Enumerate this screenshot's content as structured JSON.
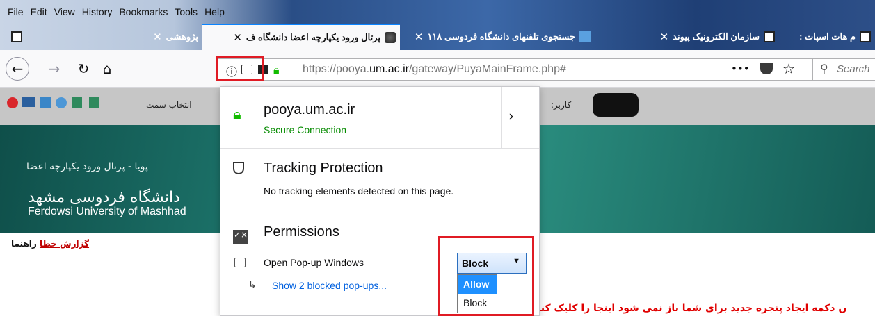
{
  "menu": [
    "File",
    "Edit",
    "View",
    "History",
    "Bookmarks",
    "Tools",
    "Help"
  ],
  "tabs": [
    {
      "label": "پژوهشی"
    },
    {
      "label": "پرتال ورود یکپارچه اعضا دانشگاه ف"
    },
    {
      "label": "جستجوی تلفنهای دانشگاه فردوسی ۱۱۸"
    },
    {
      "label": "سازمان الکترونیک پیوند"
    },
    {
      "label": "م هات اسپات :"
    }
  ],
  "nav": {
    "url_prefix": "https://pooya.",
    "url_domain": "um.ac.ir",
    "url_suffix": "/gateway/PuyaMainFrame.php#",
    "search_placeholder": "Search",
    "more": "•••"
  },
  "page": {
    "role_label": "انتخاب سمت",
    "user_label": "کاربر:",
    "banner_line1": "پویا - پرتال ورود یکپارچه اعضا",
    "banner_line2": "دانشگاه فردوسی مشهد",
    "banner_line3": "Ferdowsi University of Mashhad",
    "report_link": "گزارش خطا",
    "help_link": "راهنما",
    "bottom_message": "ن دکمه ایجاد پنجره جدید برای شما باز نمی شود اینجا را کلیک کنید"
  },
  "panel": {
    "host": "pooya.um.ac.ir",
    "connection": "Secure Connection",
    "tracking_title": "Tracking Protection",
    "tracking_desc": "No tracking elements detected on this page.",
    "permissions_title": "Permissions",
    "popup_label": "Open Pop-up Windows",
    "popup_value": "Block",
    "show_blocked": "Show 2 blocked pop-ups...",
    "options": [
      "Allow",
      "Block"
    ],
    "selected_option": "Allow"
  },
  "colors": {
    "accent": "#0a84ff",
    "secure_green": "#058b00",
    "highlight_red": "#e01b24",
    "link_blue": "#0060df"
  }
}
